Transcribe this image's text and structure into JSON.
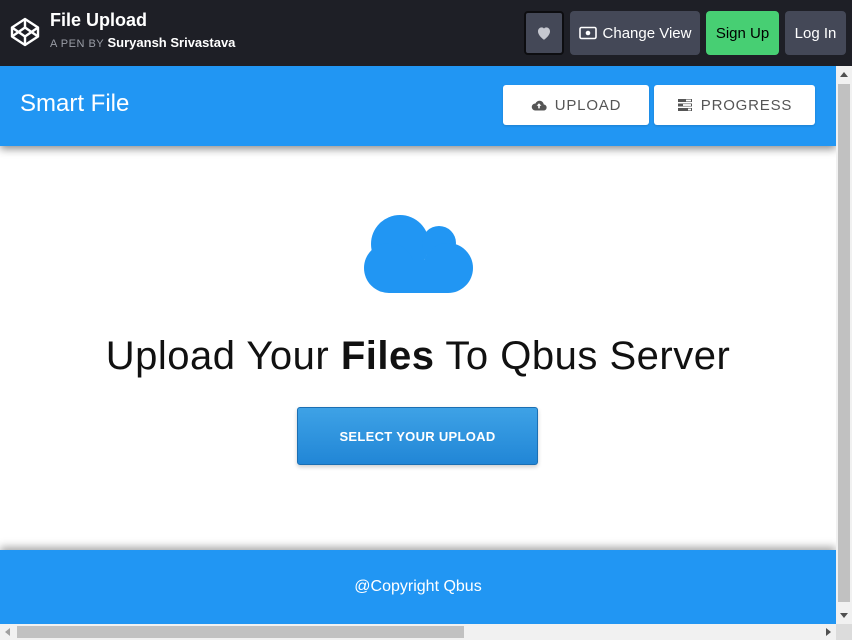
{
  "codepen": {
    "pen_title": "File Upload",
    "by_label": "A PEN BY",
    "author": "Suryansh Srivastava",
    "change_view_label": "Change View",
    "signup_label": "Sign Up",
    "login_label": "Log In",
    "colors": {
      "bar": "#1e1f26",
      "button": "#444857",
      "signup": "#47cf73"
    }
  },
  "app": {
    "brand": "Smart File",
    "nav": {
      "upload_label": "UPLOAD",
      "progress_label": "PROGRESS"
    },
    "headline_pre": "Upload Your ",
    "headline_bold": "Files",
    "headline_post": " To Qbus Server",
    "select_button_label": "SELECT YOUR UPLOAD",
    "footer_text": "@Copyright Qbus",
    "colors": {
      "primary": "#2196f3",
      "select_button": "#2b8fdf"
    },
    "icons": [
      "cloud-icon",
      "cloud-upload-icon",
      "tasks-icon",
      "heart-icon",
      "eye-icon",
      "codepen-logo-icon"
    ]
  }
}
